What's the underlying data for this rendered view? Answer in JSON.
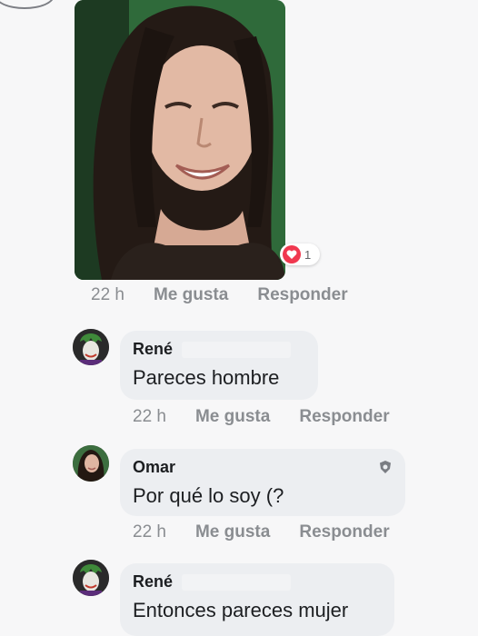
{
  "photo_comment": {
    "reaction_count": "1",
    "time": "22 h",
    "like_label": "Me gusta",
    "reply_label": "Responder"
  },
  "comments": [
    {
      "author": "René",
      "text": "Pareces hombre",
      "time": "22 h",
      "like_label": "Me gusta",
      "reply_label": "Responder"
    },
    {
      "author": "Omar",
      "text": "Por qué lo soy (?",
      "time": "22 h",
      "like_label": "Me gusta",
      "reply_label": "Responder"
    },
    {
      "author": "René",
      "text": "Entonces pareces mujer"
    }
  ],
  "colors": {
    "heart": "#f0384f",
    "bubble": "#eceef1",
    "meta_text": "#8a8d91"
  }
}
